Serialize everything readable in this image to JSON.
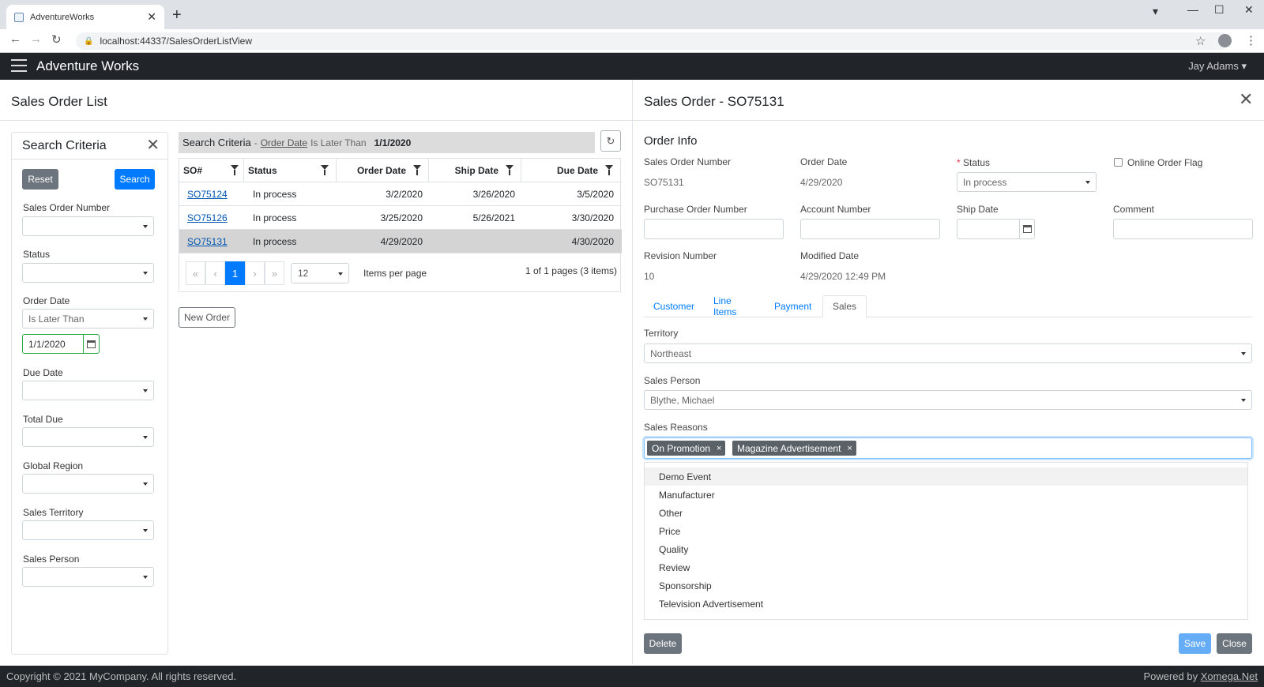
{
  "browser": {
    "tab_title": "AdventureWorks",
    "url": "localhost:44337/SalesOrderListView"
  },
  "app": {
    "brand": "Adventure Works",
    "user": "Jay Adams"
  },
  "list": {
    "title": "Sales Order List",
    "search": {
      "title": "Search Criteria",
      "reset_label": "Reset",
      "search_label": "Search",
      "fields": {
        "sales_order_number": "Sales Order Number",
        "status": "Status",
        "order_date": "Order Date",
        "order_date_operator": "Is Later Than",
        "order_date_value": "1/1/2020",
        "due_date": "Due Date",
        "total_due": "Total Due",
        "global_region": "Global Region",
        "sales_territory": "Sales Territory",
        "sales_person": "Sales Person"
      }
    },
    "criteria_bar": {
      "label": "Search Criteria",
      "dash": "-",
      "field": "Order Date",
      "operator": "Is Later Than",
      "value": "1/1/2020"
    },
    "grid": {
      "columns": [
        "SO#",
        "Status",
        "Order Date",
        "Ship Date",
        "Due Date"
      ],
      "rows": [
        {
          "so": "SO75124",
          "status": "In process",
          "order_date": "3/2/2020",
          "ship_date": "3/26/2020",
          "due_date": "3/5/2020"
        },
        {
          "so": "SO75126",
          "status": "In process",
          "order_date": "3/25/2020",
          "ship_date": "5/26/2021",
          "due_date": "3/30/2020"
        },
        {
          "so": "SO75131",
          "status": "In process",
          "order_date": "4/29/2020",
          "ship_date": "",
          "due_date": "4/30/2020"
        }
      ]
    },
    "pager": {
      "first": "«",
      "prev": "‹",
      "current": "1",
      "next": "›",
      "last": "»",
      "page_size": "12",
      "items_per_page": "Items per page",
      "info": "1 of 1 pages (3 items)"
    },
    "new_order_label": "New Order"
  },
  "detail": {
    "title": "Sales Order - SO75131",
    "section": "Order Info",
    "sales_order_number_label": "Sales Order Number",
    "sales_order_number": "SO75131",
    "order_date_label": "Order Date",
    "order_date": "4/29/2020",
    "status_label": "Status",
    "status_required": "*",
    "status": "In process",
    "online_order_flag_label": "Online Order Flag",
    "purchase_order_number_label": "Purchase Order Number",
    "account_number_label": "Account Number",
    "ship_date_label": "Ship Date",
    "comment_label": "Comment",
    "revision_number_label": "Revision Number",
    "revision_number": "10",
    "modified_date_label": "Modified Date",
    "modified_date": "4/29/2020 12:49 PM",
    "tabs": [
      "Customer",
      "Line Items",
      "Payment",
      "Sales"
    ],
    "active_tab": "Sales",
    "territory_label": "Territory",
    "territory": "Northeast",
    "sales_person_label": "Sales Person",
    "sales_person": "Blythe, Michael",
    "sales_reasons_label": "Sales Reasons",
    "selected_reasons": [
      "On Promotion",
      "Magazine Advertisement"
    ],
    "tag_remove": "×",
    "reason_options": [
      "Demo Event",
      "Manufacturer",
      "Other",
      "Price",
      "Quality",
      "Review",
      "Sponsorship",
      "Television Advertisement"
    ],
    "delete_label": "Delete",
    "save_label": "Save",
    "close_label": "Close"
  },
  "footer": {
    "copyright": "Copyright © 2021 MyCompany. All rights reserved.",
    "powered_prefix": "Powered by",
    "powered_link": "Xomega.Net"
  },
  "colors": {
    "primary": "#007bff",
    "secondary": "#6c757d",
    "navbar": "#212529",
    "valid": "#28a745",
    "required": "#dc3545"
  }
}
